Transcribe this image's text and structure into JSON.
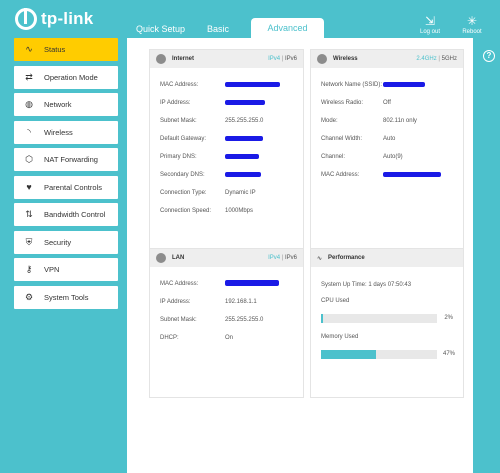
{
  "brand": {
    "name": "tp-link"
  },
  "tabs": [
    {
      "label": "Quick Setup"
    },
    {
      "label": "Basic"
    },
    {
      "label": "Advanced"
    }
  ],
  "header": {
    "logout_label": "Log out",
    "reboot_label": "Reboot"
  },
  "sidebar": {
    "items": [
      {
        "label": "Status",
        "icon": "pulse-icon",
        "glyph": "∿"
      },
      {
        "label": "Operation Mode",
        "icon": "swap-icon",
        "glyph": "⇄"
      },
      {
        "label": "Network",
        "icon": "globe-icon",
        "glyph": "◍"
      },
      {
        "label": "Wireless",
        "icon": "wifi-icon",
        "glyph": "◝"
      },
      {
        "label": "NAT Forwarding",
        "icon": "nat-icon",
        "glyph": "⬡"
      },
      {
        "label": "Parental Controls",
        "icon": "heart-icon",
        "glyph": "♥"
      },
      {
        "label": "Bandwidth Control",
        "icon": "updown-icon",
        "glyph": "⇅"
      },
      {
        "label": "Security",
        "icon": "shield-icon",
        "glyph": "⛨"
      },
      {
        "label": "VPN",
        "icon": "key-icon",
        "glyph": "⚷"
      },
      {
        "label": "System Tools",
        "icon": "gear-icon",
        "glyph": "⚙"
      }
    ]
  },
  "internet": {
    "title": "Internet",
    "ipv4": "IPv4",
    "sep": "|",
    "ipv6": "IPv6",
    "rows": [
      {
        "label": "MAC Address:",
        "value": ""
      },
      {
        "label": "IP Address:",
        "value": ""
      },
      {
        "label": "Subnet Mask:",
        "value": "255.255.255.0"
      },
      {
        "label": "Default Gateway:",
        "value": ""
      },
      {
        "label": "Primary DNS:",
        "value": ""
      },
      {
        "label": "Secondary DNS:",
        "value": ""
      },
      {
        "label": "Connection Type:",
        "value": "Dynamic IP"
      },
      {
        "label": "Connection Speed:",
        "value": "1000Mbps"
      }
    ]
  },
  "wireless": {
    "title": "Wireless",
    "band24": "2.4GHz",
    "sep": "|",
    "band5": "5GHz",
    "rows": [
      {
        "label": "Network Name (SSID):",
        "value": ""
      },
      {
        "label": "Wireless Radio:",
        "value": "Off"
      },
      {
        "label": "Mode:",
        "value": "802.11n only"
      },
      {
        "label": "Channel Width:",
        "value": "Auto"
      },
      {
        "label": "Channel:",
        "value": "Auto(9)"
      },
      {
        "label": "MAC Address:",
        "value": ""
      }
    ]
  },
  "lan": {
    "title": "LAN",
    "ipv4": "IPv4",
    "sep": "|",
    "ipv6": "IPv6",
    "rows": [
      {
        "label": "MAC Address:",
        "value": ""
      },
      {
        "label": "IP Address:",
        "value": "192.168.1.1"
      },
      {
        "label": "Subnet Mask:",
        "value": "255.255.255.0"
      },
      {
        "label": "DHCP:",
        "value": "On"
      }
    ]
  },
  "performance": {
    "title": "Performance",
    "uptime": "System Up Time: 1 days 07:50:43",
    "cpu_label": "CPU Used",
    "cpu_pct": "2%",
    "cpu_value": 2,
    "mem_label": "Memory Used",
    "mem_pct": "47%",
    "mem_value": 47
  },
  "colors": {
    "accent": "#4cc1cc",
    "active_menu": "#ffcc00",
    "redaction": "#1a1ae6"
  }
}
